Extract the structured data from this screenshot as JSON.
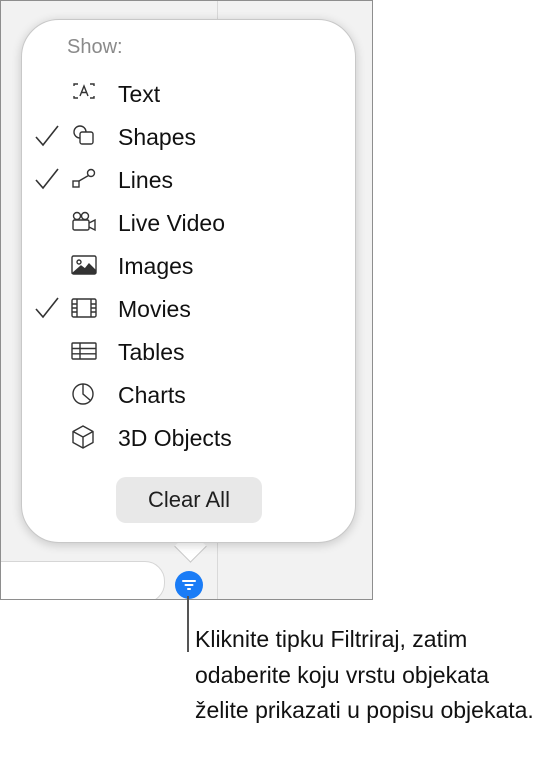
{
  "popover": {
    "heading": "Show:",
    "items": [
      {
        "label": "Text",
        "checked": false,
        "icon": "text-box-icon"
      },
      {
        "label": "Shapes",
        "checked": true,
        "icon": "shapes-icon"
      },
      {
        "label": "Lines",
        "checked": true,
        "icon": "line-icon"
      },
      {
        "label": "Live Video",
        "checked": false,
        "icon": "camera-icon"
      },
      {
        "label": "Images",
        "checked": false,
        "icon": "image-icon"
      },
      {
        "label": "Movies",
        "checked": true,
        "icon": "film-icon"
      },
      {
        "label": "Tables",
        "checked": false,
        "icon": "table-icon"
      },
      {
        "label": "Charts",
        "checked": false,
        "icon": "chart-icon"
      },
      {
        "label": "3D Objects",
        "checked": false,
        "icon": "cube-icon"
      }
    ],
    "clear_label": "Clear All"
  },
  "filter_button": {
    "icon": "filter-icon",
    "color": "#1a7cf6"
  },
  "callout": {
    "text": "Kliknite tipku Filtriraj, zatim odaberite koju vrstu objekata želite prikazati u popisu objekata."
  }
}
